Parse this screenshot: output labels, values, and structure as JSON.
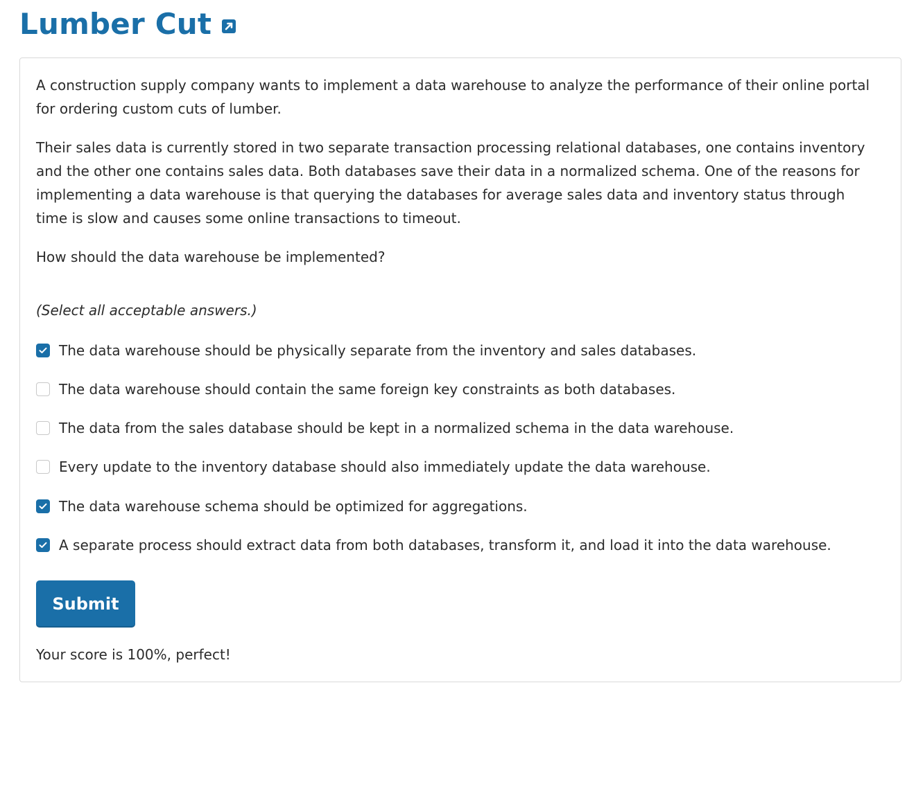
{
  "header": {
    "title": "Lumber Cut",
    "link_icon": "external-link-icon"
  },
  "question": {
    "paragraphs": [
      "A construction supply company wants to implement a data warehouse to analyze the performance of their online portal for ordering custom cuts of lumber.",
      "Their sales data is currently stored in two separate transaction processing relational databases, one contains inventory and the other one contains sales data. Both databases save their data in a normalized schema. One of the reasons for implementing a data warehouse is that querying the databases for average sales data and inventory status through time is slow and causes some online transactions to timeout.",
      "How should the data warehouse be implemented?"
    ],
    "instruction": "(Select all acceptable answers.)",
    "options": [
      {
        "label": "The data warehouse should be physically separate from the inventory and sales databases.",
        "checked": true
      },
      {
        "label": "The data warehouse should contain the same foreign key constraints as both databases.",
        "checked": false
      },
      {
        "label": "The data from the sales database should be kept in a normalized schema in the data warehouse.",
        "checked": false
      },
      {
        "label": "Every update to the inventory database should also immediately update the data warehouse.",
        "checked": false
      },
      {
        "label": "The data warehouse schema should be optimized for aggregations.",
        "checked": true
      },
      {
        "label": "A separate process should extract data from both databases, transform it, and load it into the data warehouse.",
        "checked": true
      }
    ]
  },
  "actions": {
    "submit_label": "Submit"
  },
  "result": {
    "score_text": "Your score is 100%, perfect!"
  },
  "colors": {
    "accent": "#1a6fa8",
    "text": "#2b2b2b",
    "border": "#d9d9d9"
  }
}
